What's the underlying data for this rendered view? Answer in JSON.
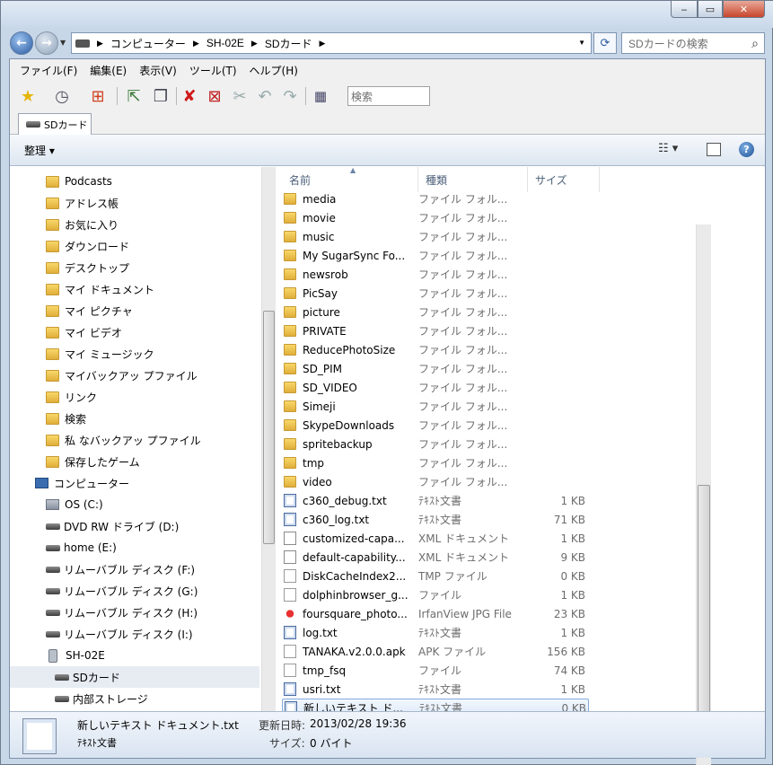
{
  "window": {
    "minimize_glyph": "‒",
    "maximize_glyph": "▭",
    "close_glyph": "✕"
  },
  "address": {
    "crumbs": [
      "コンピューター",
      "SH-02E",
      "SDカード"
    ],
    "search_placeholder": "SDカードの検索"
  },
  "menu": [
    "ファイル(F)",
    "編集(E)",
    "表示(V)",
    "ツール(T)",
    "ヘルプ(H)"
  ],
  "toolbar": {
    "search_placeholder": "検索",
    "icons": [
      "star-icon",
      "history-icon",
      "windows-icon",
      "move-icon",
      "copy-icon",
      "delete-icon",
      "delete-alt-icon",
      "cut-icon",
      "undo-icon",
      "redo-icon",
      "view-icon"
    ]
  },
  "tab": {
    "label": "SDカード"
  },
  "commandbar": {
    "organize": "整理 ▾",
    "view": "▾",
    "help": "?"
  },
  "nav": {
    "items": [
      {
        "label": "Podcasts",
        "icon": "folder-icon",
        "indent": 1
      },
      {
        "label": "アドレス帳",
        "icon": "folder-icon",
        "indent": 1
      },
      {
        "label": "お気に入り",
        "icon": "folder-icon",
        "indent": 1
      },
      {
        "label": "ダウンロード",
        "icon": "folder-icon",
        "indent": 1
      },
      {
        "label": "デスクトップ",
        "icon": "folder-icon",
        "indent": 1
      },
      {
        "label": "マイ ドキュメント",
        "icon": "folder-icon",
        "indent": 1
      },
      {
        "label": "マイ ピクチャ",
        "icon": "folder-icon",
        "indent": 1
      },
      {
        "label": "マイ ビデオ",
        "icon": "folder-icon",
        "indent": 1
      },
      {
        "label": "マイ ミュージック",
        "icon": "folder-icon",
        "indent": 1
      },
      {
        "label": "マイバックアッ プファイル",
        "icon": "folder-icon",
        "indent": 1
      },
      {
        "label": "リンク",
        "icon": "folder-icon",
        "indent": 1
      },
      {
        "label": "検索",
        "icon": "folder-icon",
        "indent": 1
      },
      {
        "label": "私 なバックアッ プファイル",
        "icon": "folder-icon",
        "indent": 1
      },
      {
        "label": "保存したゲーム",
        "icon": "folder-icon",
        "indent": 1
      },
      {
        "label": "コンピューター",
        "icon": "computer-icon",
        "indent": 0
      },
      {
        "label": "OS (C:)",
        "icon": "os-drive-icon",
        "indent": 1
      },
      {
        "label": "DVD RW ドライブ (D:)",
        "icon": "dvd-drive-icon",
        "indent": 1
      },
      {
        "label": "home (E:)",
        "icon": "drive-icon",
        "indent": 1
      },
      {
        "label": "リムーバブル ディスク (F:)",
        "icon": "drive-icon",
        "indent": 1
      },
      {
        "label": "リムーバブル ディスク (G:)",
        "icon": "drive-icon",
        "indent": 1
      },
      {
        "label": "リムーバブル ディスク (H:)",
        "icon": "drive-icon",
        "indent": 1
      },
      {
        "label": "リムーバブル ディスク (I:)",
        "icon": "drive-icon",
        "indent": 1
      },
      {
        "label": "SH-02E",
        "icon": "phone-icon",
        "indent": 1
      },
      {
        "label": "SDカード",
        "icon": "drive-icon",
        "indent": 2,
        "selected": true
      },
      {
        "label": "内部ストレージ",
        "icon": "drive-icon",
        "indent": 2
      }
    ]
  },
  "columns": {
    "name": "名前",
    "type": "種類",
    "size": "サイズ"
  },
  "files": [
    {
      "name": "media",
      "type": "ファイル フォル...",
      "size": "",
      "icon": "folder"
    },
    {
      "name": "movie",
      "type": "ファイル フォル...",
      "size": "",
      "icon": "folder"
    },
    {
      "name": "music",
      "type": "ファイル フォル...",
      "size": "",
      "icon": "folder"
    },
    {
      "name": "My SugarSync Fo...",
      "type": "ファイル フォル...",
      "size": "",
      "icon": "folder"
    },
    {
      "name": "newsrob",
      "type": "ファイル フォル...",
      "size": "",
      "icon": "folder"
    },
    {
      "name": "PicSay",
      "type": "ファイル フォル...",
      "size": "",
      "icon": "folder"
    },
    {
      "name": "picture",
      "type": "ファイル フォル...",
      "size": "",
      "icon": "folder"
    },
    {
      "name": "PRIVATE",
      "type": "ファイル フォル...",
      "size": "",
      "icon": "folder"
    },
    {
      "name": "ReducePhotoSize",
      "type": "ファイル フォル...",
      "size": "",
      "icon": "folder"
    },
    {
      "name": "SD_PIM",
      "type": "ファイル フォル...",
      "size": "",
      "icon": "folder"
    },
    {
      "name": "SD_VIDEO",
      "type": "ファイル フォル...",
      "size": "",
      "icon": "folder"
    },
    {
      "name": "Simeji",
      "type": "ファイル フォル...",
      "size": "",
      "icon": "folder"
    },
    {
      "name": "SkypeDownloads",
      "type": "ファイル フォル...",
      "size": "",
      "icon": "folder"
    },
    {
      "name": "spritebackup",
      "type": "ファイル フォル...",
      "size": "",
      "icon": "folder"
    },
    {
      "name": "tmp",
      "type": "ファイル フォル...",
      "size": "",
      "icon": "folder"
    },
    {
      "name": "video",
      "type": "ファイル フォル...",
      "size": "",
      "icon": "folder"
    },
    {
      "name": "c360_debug.txt",
      "type": "ﾃｷｽﾄ文書",
      "size": "1 KB",
      "icon": "txt"
    },
    {
      "name": "c360_log.txt",
      "type": "ﾃｷｽﾄ文書",
      "size": "71 KB",
      "icon": "txt"
    },
    {
      "name": "customized-capa...",
      "type": "XML ドキュメント",
      "size": "1 KB",
      "icon": "xml"
    },
    {
      "name": "default-capability...",
      "type": "XML ドキュメント",
      "size": "9 KB",
      "icon": "xml"
    },
    {
      "name": "DiskCacheIndex2...",
      "type": "TMP ファイル",
      "size": "0 KB",
      "icon": "plain"
    },
    {
      "name": "dolphinbrowser_g...",
      "type": "ファイル",
      "size": "1 KB",
      "icon": "plain"
    },
    {
      "name": "foursquare_photo...",
      "type": "IrfanView JPG File",
      "size": "23 KB",
      "icon": "jpg"
    },
    {
      "name": "log.txt",
      "type": "ﾃｷｽﾄ文書",
      "size": "1 KB",
      "icon": "txt"
    },
    {
      "name": "TANAKA.v2.0.0.apk",
      "type": "APK ファイル",
      "size": "156 KB",
      "icon": "plain"
    },
    {
      "name": "tmp_fsq",
      "type": "ファイル",
      "size": "74 KB",
      "icon": "plain"
    },
    {
      "name": "usri.txt",
      "type": "ﾃｷｽﾄ文書",
      "size": "1 KB",
      "icon": "txt"
    },
    {
      "name": "新しいテキスト ド...",
      "type": "ﾃｷｽﾄ文書",
      "size": "0 KB",
      "icon": "txt",
      "selected": true
    }
  ],
  "details": {
    "name": "新しいテキスト ドキュメント.txt",
    "type": "ﾃｷｽﾄ文書",
    "modified_label": "更新日時:",
    "modified": "2013/02/28 19:36",
    "size_label": "サイズ:",
    "size": "0 バイト"
  }
}
